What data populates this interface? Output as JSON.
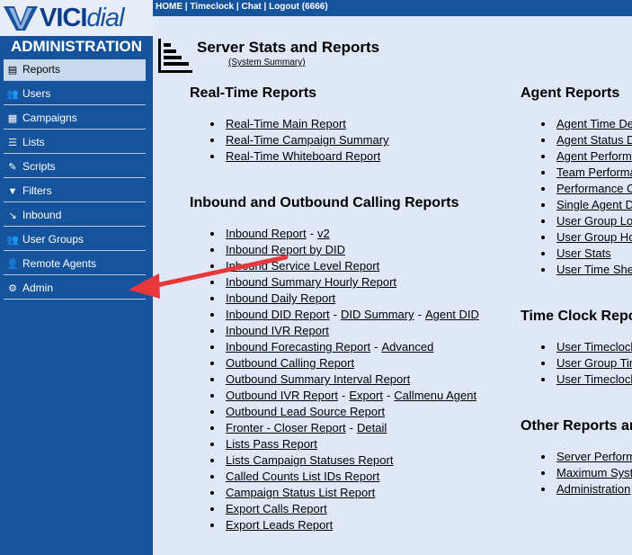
{
  "logo": {
    "part1": "VICI",
    "part2": "dial"
  },
  "sidebar": {
    "title": "ADMINISTRATION",
    "items": [
      {
        "label": "Reports",
        "icon": "bar-chart-icon"
      },
      {
        "label": "Users",
        "icon": "users-icon"
      },
      {
        "label": "Campaigns",
        "icon": "campaigns-icon"
      },
      {
        "label": "Lists",
        "icon": "list-icon"
      },
      {
        "label": "Scripts",
        "icon": "script-icon"
      },
      {
        "label": "Filters",
        "icon": "filter-icon"
      },
      {
        "label": "Inbound",
        "icon": "phone-inbound-icon"
      },
      {
        "label": "User Groups",
        "icon": "user-groups-icon"
      },
      {
        "label": "Remote Agents",
        "icon": "remote-agents-icon"
      },
      {
        "label": "Admin",
        "icon": "gear-icon"
      }
    ]
  },
  "topnav": {
    "home": "HOME",
    "timeclock": "Timeclock",
    "chat": "Chat",
    "logout": "Logout (6666)",
    "sep": "|"
  },
  "header": {
    "title": "Server Stats and Reports",
    "subtitle": "(System Summary)"
  },
  "realtime": {
    "heading": "Real-Time Reports",
    "links": [
      "Real-Time Main Report",
      "Real-Time Campaign Summary",
      "Real-Time Whiteboard Report"
    ]
  },
  "calling": {
    "heading": "Inbound and Outbound Calling Reports",
    "sep": "-",
    "rows": [
      [
        "Inbound Report",
        "v2"
      ],
      [
        "Inbound Report by DID"
      ],
      [
        "Inbound Service Level Report"
      ],
      [
        "Inbound Summary Hourly Report"
      ],
      [
        "Inbound Daily Report"
      ],
      [
        "Inbound DID Report",
        "DID Summary",
        "Agent DID"
      ],
      [
        "Inbound IVR Report"
      ],
      [
        "Inbound Forecasting Report",
        "Advanced"
      ],
      [
        "Outbound Calling Report"
      ],
      [
        "Outbound Summary Interval Report"
      ],
      [
        "Outbound IVR Report",
        "Export",
        "Callmenu Agent"
      ],
      [
        "Outbound Lead Source Report"
      ],
      [
        "Fronter - Closer Report",
        "Detail"
      ],
      [
        "Lists Pass Report"
      ],
      [
        "Lists Campaign Statuses Report"
      ],
      [
        "Called Counts List IDs Report"
      ],
      [
        "Campaign Status List Report"
      ],
      [
        "Export Calls Report"
      ],
      [
        "Export Leads Report"
      ]
    ]
  },
  "agent": {
    "heading": "Agent Reports",
    "links": [
      "Agent Time De",
      "Agent Status D",
      "Agent Perform",
      "Team Performa",
      "Performance C",
      "Single Agent D",
      "User Group Lo",
      "User Group Ho",
      "User Stats",
      "User Time She"
    ]
  },
  "timeclock_section": {
    "heading": "Time Clock Repo",
    "links": [
      "User Timeclock",
      "User Group Tim",
      "User Timeclock"
    ]
  },
  "other": {
    "heading": "Other Reports an",
    "links": [
      "Server Perform",
      "Maximum Syst",
      "Administration"
    ]
  },
  "colors": {
    "sidebar": "#16539d",
    "content_bg": "#e0e8f7",
    "annotation_arrow": "#e8383b"
  }
}
